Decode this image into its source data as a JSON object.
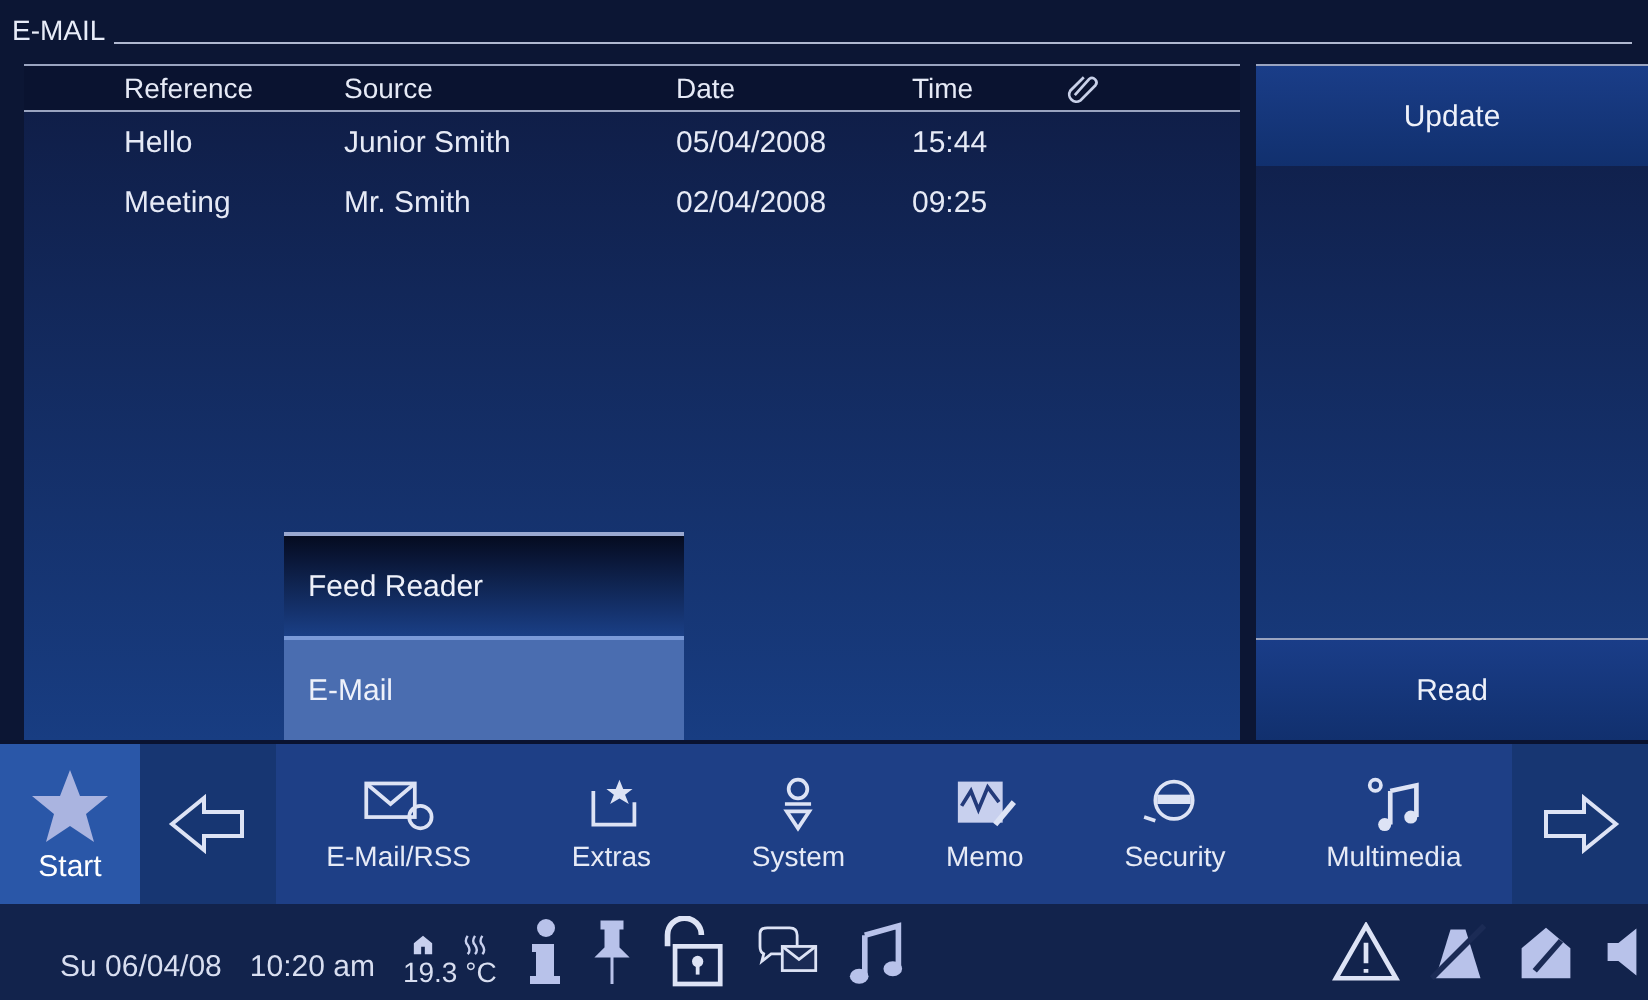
{
  "window": {
    "title": "E-MAIL"
  },
  "table": {
    "columns": [
      "Reference",
      "Source",
      "Date",
      "Time"
    ],
    "rows": [
      [
        "Hello",
        "Junior Smith",
        "05/04/2008",
        "15:44"
      ],
      [
        "Meeting",
        "Mr. Smith",
        "02/04/2008",
        "09:25"
      ]
    ]
  },
  "side_buttons": [
    "Update",
    "Read"
  ],
  "menu": [
    {
      "label": "Feed Reader",
      "selected": false
    },
    {
      "label": "E-Mail",
      "selected": true
    }
  ],
  "start": {
    "label": "Start",
    "selected": true
  },
  "nav": [
    {
      "kind": "email",
      "label": "E-Mail/RSS"
    },
    {
      "kind": "extras",
      "label": "Extras"
    },
    {
      "kind": "system",
      "label": "System"
    },
    {
      "kind": "memo",
      "label": "Memo"
    },
    {
      "kind": "security",
      "label": "Security"
    },
    {
      "kind": "multimedia",
      "label": "Multimedia"
    }
  ],
  "status_bar": {
    "date": "Su 06/04/08",
    "time": "10:20 am",
    "temperature": "19.3 °C"
  }
}
